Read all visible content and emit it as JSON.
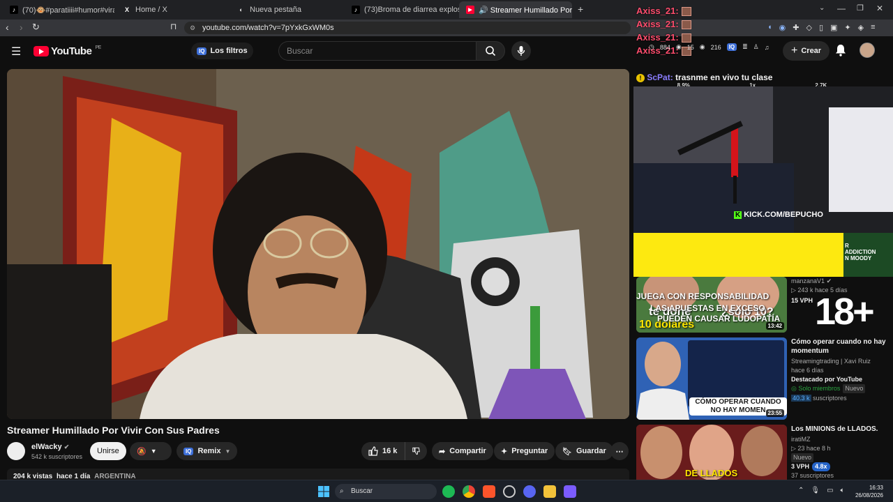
{
  "browser": {
    "tabs": [
      {
        "label": "(70)🐵#paratiiii#humor#viraltiktok",
        "fav": "♪"
      },
      {
        "label": "Home / X",
        "fav": "X"
      },
      {
        "label": "Nueva pestaña",
        "fav": "◐"
      },
      {
        "label": "(73)Broma de diarrea explosiva al cor",
        "fav": "♪"
      },
      {
        "label": "🔊 Streamer Humillado Por Vivir",
        "fav": "▶"
      }
    ],
    "url": "youtube.com/watch?v=7pYxkGxWM0s"
  },
  "youtube": {
    "logo": "YouTube",
    "logo_country": "PE",
    "filters_label": "Los filtros",
    "iq_badge": "IQ",
    "search_placeholder": "Buscar",
    "create_label": "Crear"
  },
  "video": {
    "title": "Streamer Humillado Por Vivir Con Sus Padres",
    "channel": "elWacky",
    "subscribers": "542 k suscriptores",
    "join_label": "Unirse",
    "remix_label": "Remix",
    "likes": "16 k",
    "share_label": "Compartir",
    "ask_label": "Preguntar",
    "save_label": "Guardar",
    "views": "204 k vistas",
    "age": "hace 1 día",
    "location": "ARGENTINA"
  },
  "overlay": {
    "chat_user": "Axiss_21:",
    "stats": [
      "884",
      "15",
      "216"
    ],
    "sc_user": "ScPat:",
    "sc_message": "trasnme en vivo tu clase",
    "stat_values": [
      "8.9%",
      "1x",
      "2.7K"
    ],
    "kick_url": "KICK.COM/BEPUCHO",
    "right_banner": [
      "R",
      "ADDICTION",
      "N MOODY"
    ],
    "warning_line1": "JUEGA CON RESPONSABILIDAD",
    "warning_line2": "LAS APUESTAS EN EXCESO",
    "warning_line3": "PUEDEN CAUSAR LUDOPATÍA",
    "age_badge": "18+"
  },
  "recommendations": [
    {
      "title": "",
      "channel": "manzanaV1",
      "meta": "▷ 243 k   hace 5 días",
      "extra": "15 VPH",
      "duration": "13:42",
      "thumb_text1": "te doné",
      "thumb_text2": "10 dolares",
      "thumb_text3": "¿solo 10?"
    },
    {
      "title": "Cómo operar cuando no hay momentum",
      "channel": "Streamingtrading | Xavi Ruiz",
      "meta": "hace 6 días",
      "featured": "Destacado por YouTube",
      "members": "Solo miembros",
      "new_badge": "Nuevo",
      "subs_highlight": "40.3 k",
      "subs_suffix": "suscriptores",
      "duration": "23:55",
      "thumb_text": "CÓMO OPERAR CUANDO NO HAY MOMEN"
    },
    {
      "title": "Los MINIONS de LLADOS.",
      "channel": "iratiMZ",
      "meta": "▷ 23   hace 8 h",
      "new_badge": "Nuevo",
      "vph": "3 VPH",
      "ratio": "4.8x",
      "subs": "37 suscriptores",
      "thumb_text": "DE LLADOS"
    }
  ],
  "taskbar": {
    "search_label": "Buscar",
    "time": "16:33",
    "date": "26/08/2026"
  }
}
